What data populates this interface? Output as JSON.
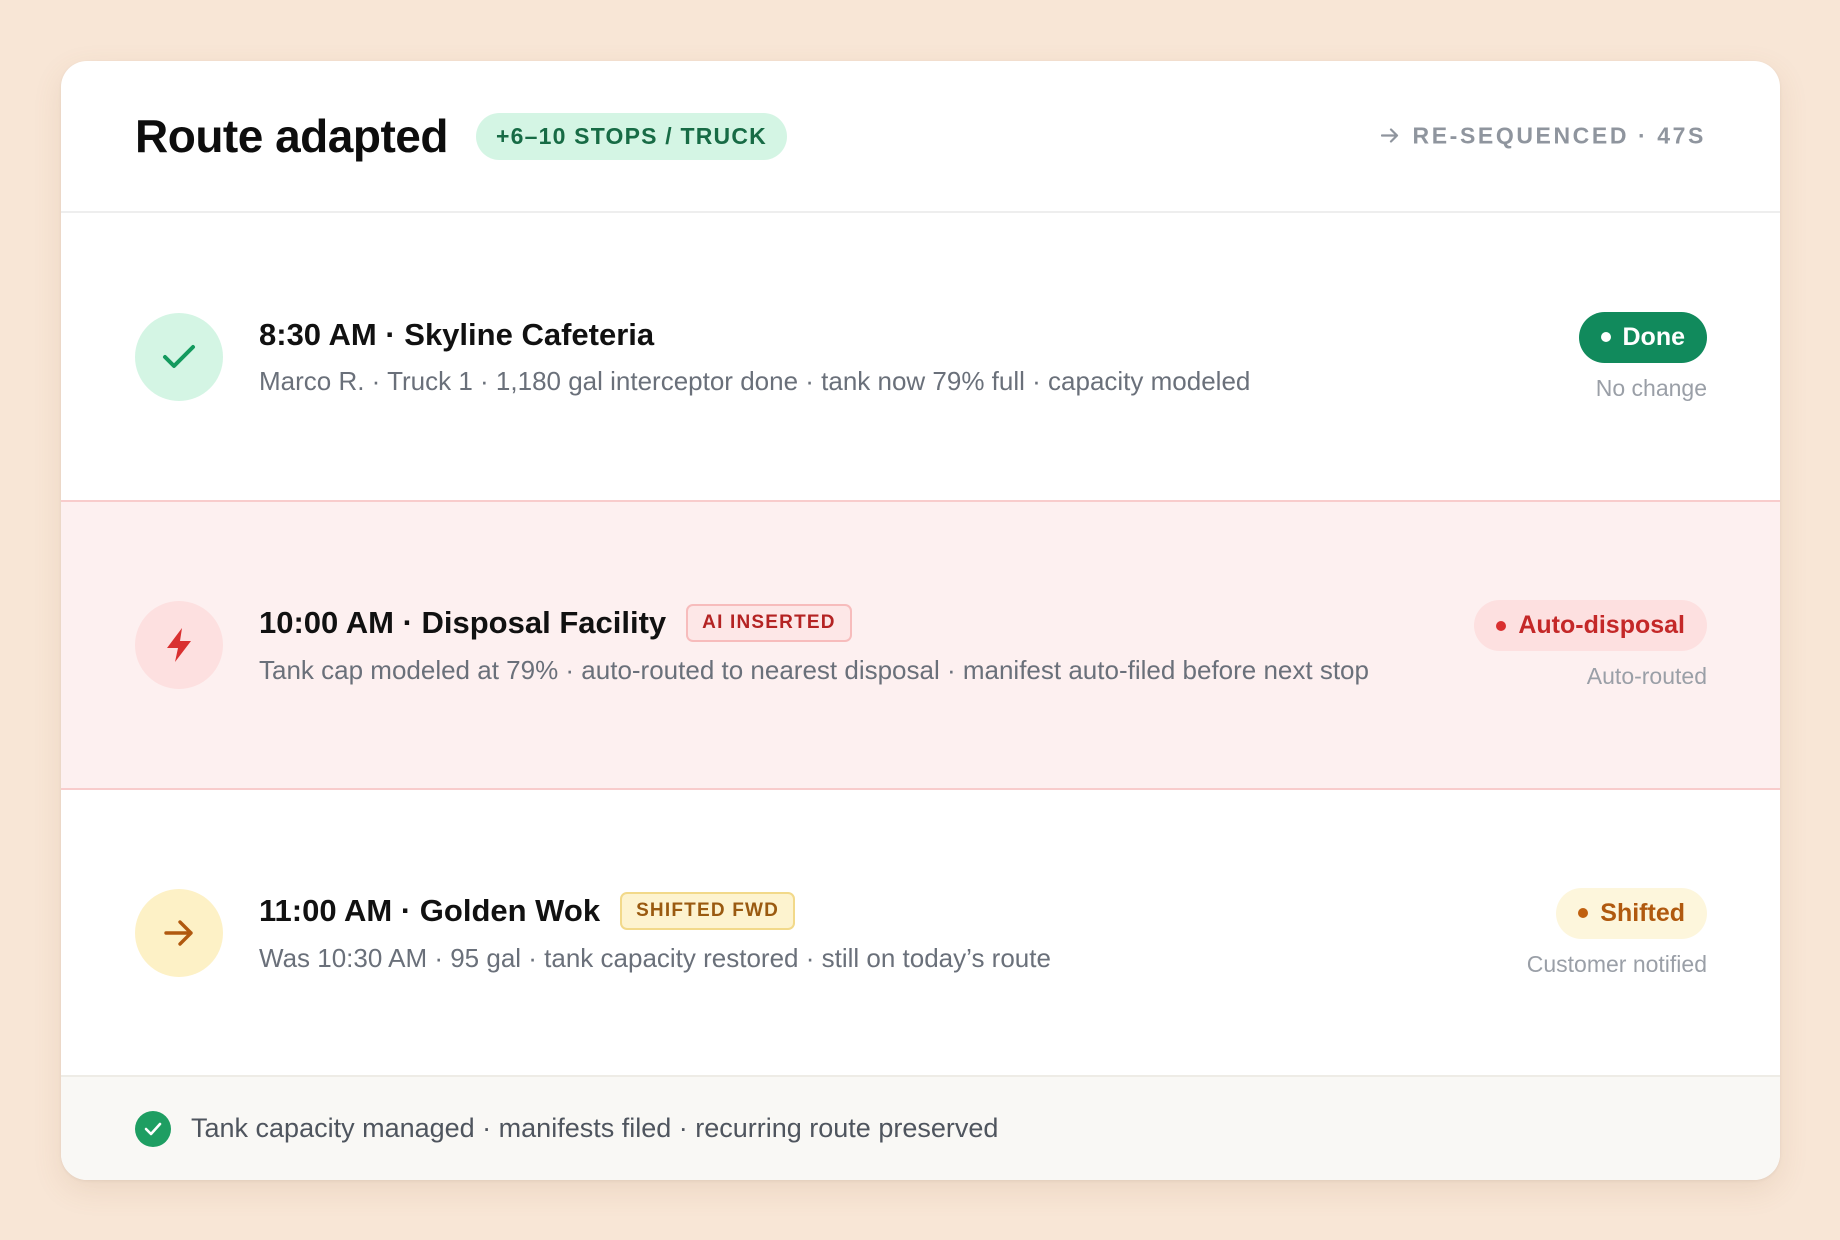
{
  "header": {
    "title": "Route adapted",
    "badge": "+6–10 STOPS / TRUCK",
    "resequenced": "RE-SEQUENCED · 47S"
  },
  "stops": [
    {
      "title": "8:30 AM · Skyline Cafeteria",
      "detail": "Marco R. · Truck 1 · 1,180 gal interceptor done · tank now 79% full · capacity modeled",
      "status": "Done",
      "status_note": "No change",
      "icon": "check-icon"
    },
    {
      "title": "10:00 AM · Disposal Facility",
      "tag": "AI INSERTED",
      "detail": "Tank cap modeled at 79% · auto-routed to nearest disposal · manifest auto-filed before next stop",
      "status": "Auto-disposal",
      "status_note": "Auto-routed",
      "icon": "lightning-icon"
    },
    {
      "title": "11:00 AM · Golden Wok",
      "tag": "SHIFTED FWD",
      "detail": "Was 10:30 AM · 95 gal · tank capacity restored · still on today’s route",
      "status": "Shifted",
      "status_note": "Customer notified",
      "icon": "arrow-right-icon"
    }
  ],
  "footer": {
    "text": "Tank capacity managed · manifests filed · recurring route preserved"
  },
  "colors": {
    "background": "#f8e6d6",
    "done_green": "#118a5c",
    "alert_red": "#c42828",
    "shift_orange": "#b0590f"
  }
}
